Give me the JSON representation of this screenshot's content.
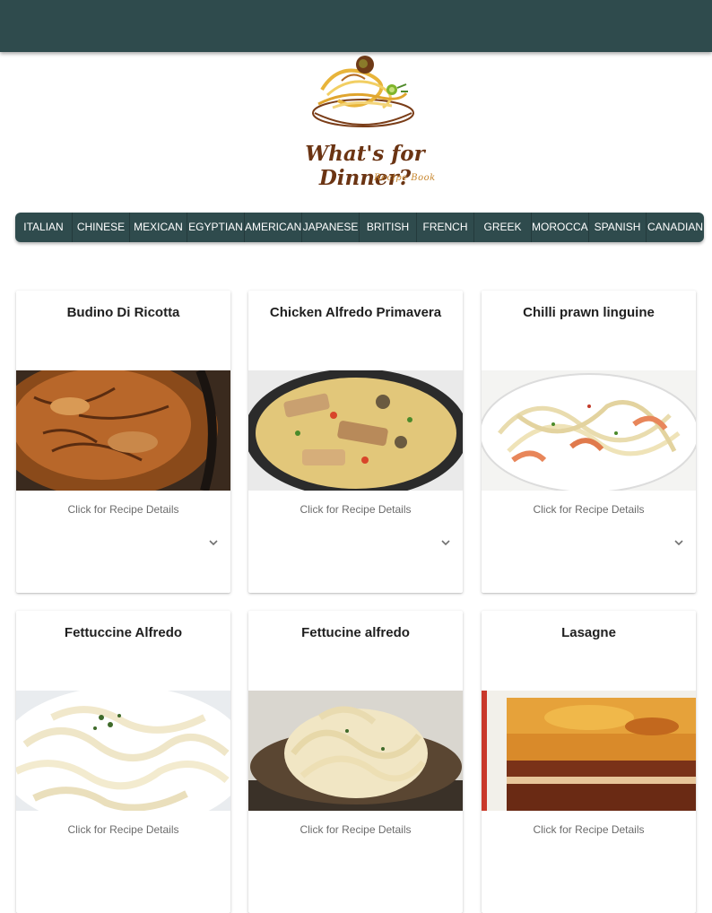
{
  "logo": {
    "title": "What's for Dinner?",
    "subtitle": "Recipe Book"
  },
  "nav": {
    "items": [
      "ITALIAN",
      "CHINESE",
      "MEXICAN",
      "EGYPTIAN",
      "AMERICAN",
      "JAPANESE",
      "BRITISH",
      "FRENCH",
      "GREEK",
      "MOROCCAN",
      "SPANISH",
      "CANADIAN"
    ]
  },
  "recipes": [
    {
      "title": "Budino Di Ricotta",
      "link": "Click for Recipe Details",
      "expand_icon": "chevron-down-icon"
    },
    {
      "title": "Chicken Alfredo Primavera",
      "link": "Click for Recipe Details",
      "expand_icon": "chevron-down-icon"
    },
    {
      "title": "Chilli prawn linguine",
      "link": "Click for Recipe Details",
      "expand_icon": "chevron-down-icon"
    },
    {
      "title": "Fettuccine Alfredo",
      "link": "Click for Recipe Details"
    },
    {
      "title": "Fettucine alfredo",
      "link": "Click for Recipe Details"
    },
    {
      "title": "Lasagne",
      "link": "Click for Recipe Details"
    }
  ],
  "colors": {
    "header": "#2f4b4d",
    "nav": "#2f4b4d",
    "logo_text": "#6b3413",
    "logo_sub": "#c8872f"
  }
}
